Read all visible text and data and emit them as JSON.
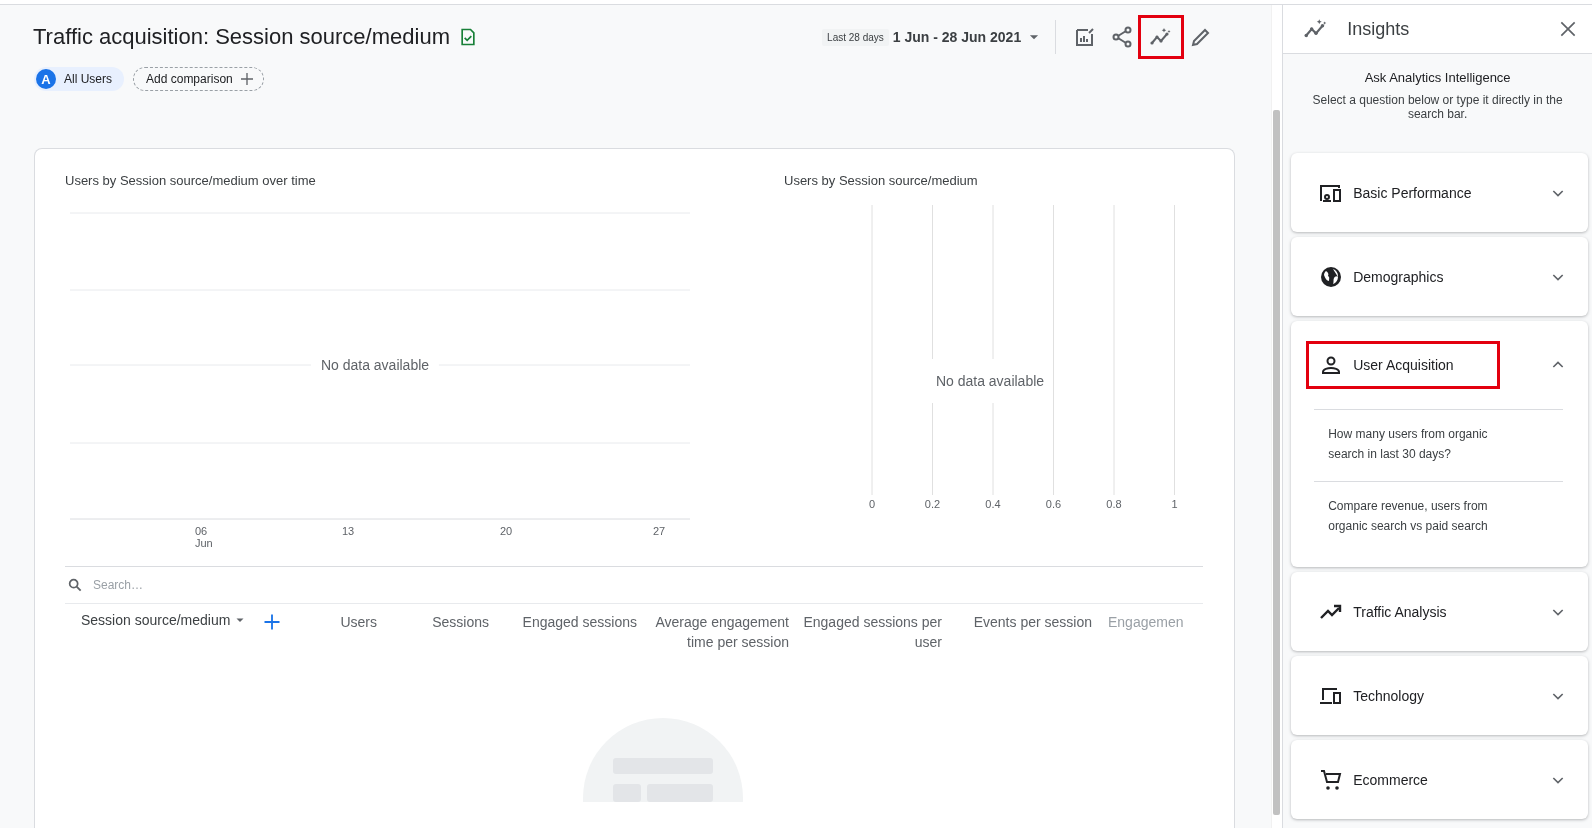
{
  "header": {
    "title": "Traffic acquisition: Session source/medium",
    "date_preset": "Last 28 days",
    "date_range": "1 Jun - 28 Jun 2021",
    "toolbar": [
      {
        "kind": "customize",
        "highlighted": false
      },
      {
        "kind": "share",
        "highlighted": false
      },
      {
        "kind": "insights",
        "highlighted": true
      },
      {
        "kind": "edit",
        "highlighted": false
      }
    ]
  },
  "comparisons": {
    "segment_badge": "A",
    "segment_label": "All Users",
    "add_button": "Add comparison"
  },
  "charts": [
    {
      "kind": "time",
      "title": "Users by Session source/medium over time",
      "empty_message": "No data available",
      "x_labels": [
        {
          "label": "06",
          "sublabel": "Jun"
        },
        {
          "label": "13"
        },
        {
          "label": "20"
        },
        {
          "label": "27"
        }
      ]
    },
    {
      "kind": "bar",
      "title": "Users by Session source/medium",
      "empty_message": "No data available",
      "x_labels": [
        {
          "label": "0"
        },
        {
          "label": "0.2"
        },
        {
          "label": "0.4"
        },
        {
          "label": "0.6"
        },
        {
          "label": "0.8"
        },
        {
          "label": "1"
        }
      ]
    }
  ],
  "table": {
    "search_placeholder": "Search…",
    "columns": [
      {
        "kind": "dimension",
        "label": "Session source/medium"
      },
      {
        "kind": "metric",
        "label": "Users"
      },
      {
        "kind": "metric",
        "label": "Sessions"
      },
      {
        "kind": "metric",
        "label": "Engaged sessions"
      },
      {
        "kind": "metric",
        "label": "Average engagement time per session"
      },
      {
        "kind": "metric",
        "label": "Engaged sessions per user"
      },
      {
        "kind": "metric",
        "label": "Events per session"
      },
      {
        "kind": "cut",
        "label": "Engagemen"
      }
    ]
  },
  "insights": {
    "title": "Insights",
    "heading": "Ask Analytics Intelligence",
    "subtitle": "Select a question below or type it directly in the search bar.",
    "sections": [
      {
        "kind": "performance",
        "label": "Basic Performance",
        "expanded": false,
        "highlighted": false
      },
      {
        "kind": "globe",
        "label": "Demographics",
        "expanded": false,
        "highlighted": false
      },
      {
        "kind": "person",
        "label": "User Acquisition",
        "expanded": true,
        "highlighted": true,
        "questions": [
          "How many users from organic search in last 30 days?",
          "Compare revenue, users from organic search vs paid search"
        ]
      },
      {
        "kind": "trend",
        "label": "Traffic Analysis",
        "expanded": false,
        "highlighted": false
      },
      {
        "kind": "devices",
        "label": "Technology",
        "expanded": false,
        "highlighted": false
      },
      {
        "kind": "cart",
        "label": "Ecommerce",
        "expanded": false,
        "highlighted": false
      }
    ]
  }
}
